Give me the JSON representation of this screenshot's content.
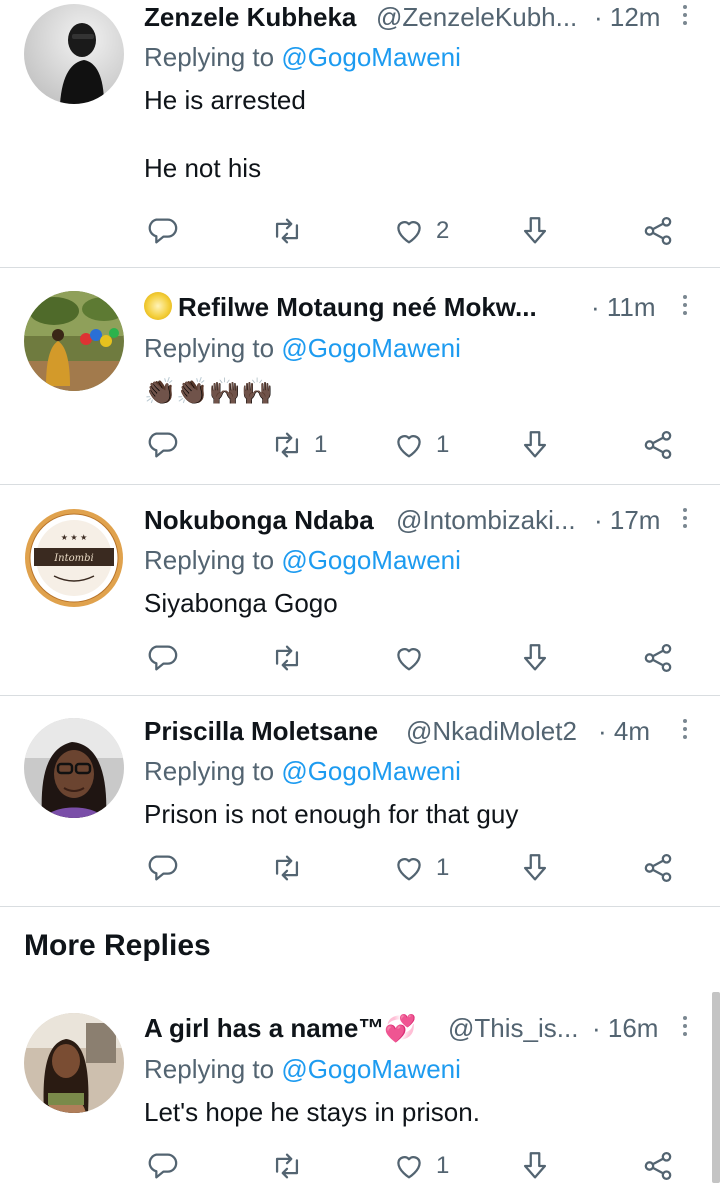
{
  "tweets": [
    {
      "name": "Zenzele Kubheka",
      "handle": "@ZenzeleKubh...",
      "time": "· 12m",
      "replying_label": "Replying to ",
      "replying_handle": "@GogoMaweni",
      "text": "He is arrested\n\nHe not his",
      "retweets": "",
      "likes": "2"
    },
    {
      "name": "Refilwe Motaung neé Mokw...",
      "handle": "",
      "time": "· 11m",
      "replying_label": "Replying to ",
      "replying_handle": "@GogoMaweni",
      "text": "👏🏿👏🏿🙌🏿🙌🏿",
      "retweets": "1",
      "likes": "1"
    },
    {
      "name": "Nokubonga Ndaba",
      "handle": "@Intombizaki...",
      "time": "· 17m",
      "replying_label": "Replying to ",
      "replying_handle": "@GogoMaweni",
      "text": "Siyabonga Gogo",
      "retweets": "",
      "likes": ""
    },
    {
      "name": "Priscilla Moletsane",
      "handle": "@NkadiMolet2",
      "time": "· 4m",
      "replying_label": "Replying to ",
      "replying_handle": "@GogoMaweni",
      "text": "Prison is not enough for that guy",
      "retweets": "",
      "likes": "1"
    },
    {
      "name": "A girl has a name™💞",
      "handle": "@This_is...",
      "time": "· 16m",
      "replying_label": "Replying to ",
      "replying_handle": "@GogoMaweni",
      "text": "Let's hope he stays in prison.",
      "retweets": "",
      "likes": "1"
    }
  ],
  "more_replies_label": "More Replies",
  "icons": {
    "reply": "reply-icon",
    "retweet": "retweet-icon",
    "like": "heart-icon",
    "save": "download-arrow-icon",
    "share": "share-icon",
    "more": "more-vertical-icon"
  },
  "colors": {
    "text": "#0f1419",
    "secondary": "#536471",
    "link": "#1d9bf0",
    "divider": "#d9dde0"
  }
}
